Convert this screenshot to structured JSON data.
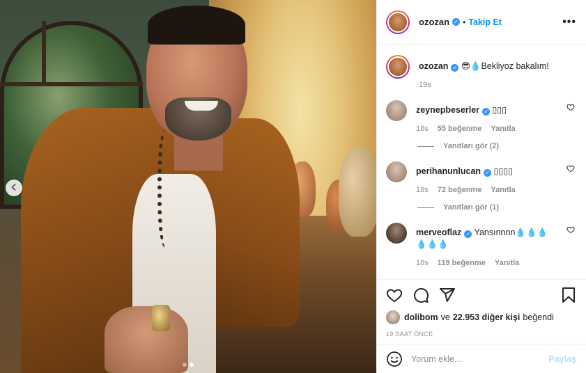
{
  "post": {
    "username": "ozozan",
    "follow_label": "Takip Et",
    "more_label": "•••",
    "separator": "•"
  },
  "caption": {
    "username": "ozozan",
    "text": "😎💧Bekliyoz bakalım!",
    "time": "19s"
  },
  "comments": [
    {
      "username": "zeynepbeserler",
      "text": "▯▯▯",
      "time": "18s",
      "likes": "55 beğenme",
      "reply_label": "Yanıtla",
      "view_replies": "Yanıtları gör (2)"
    },
    {
      "username": "perihanunlucan",
      "text": "▯▯▯▯",
      "time": "18s",
      "likes": "72 beğenme",
      "reply_label": "Yanıtla",
      "view_replies": "Yanıtları gör (1)"
    },
    {
      "username": "merveoflaz",
      "text": "Yansınnnn",
      "drops_line1": "💧💧💧",
      "drops_line2": "💧💧💧",
      "time": "18s",
      "likes": "119 beğenme",
      "reply_label": "Yanıtla"
    }
  ],
  "likes": {
    "user": "dolibom",
    "connector": "ve",
    "others": "22.953 diğer kişi",
    "suffix": "beğendi"
  },
  "time_ago": "19 SAAT ÖNCE",
  "comment_box": {
    "placeholder": "Yorum ekle...",
    "post_label": "Paylaş"
  },
  "carousel": {
    "total": 2,
    "active": 2
  },
  "colors": {
    "accent": "#0095f6",
    "verified": "#3897f0",
    "muted": "#8e8e8e",
    "post_disabled": "#b2dffc"
  },
  "icons": {
    "header_more": "more-horizontal-icon",
    "like": "heart-icon",
    "comment": "comment-icon",
    "share": "send-icon",
    "save": "bookmark-icon",
    "emoji": "smiley-icon",
    "prev": "chevron-left-icon",
    "verified": "verified-badge-icon"
  }
}
